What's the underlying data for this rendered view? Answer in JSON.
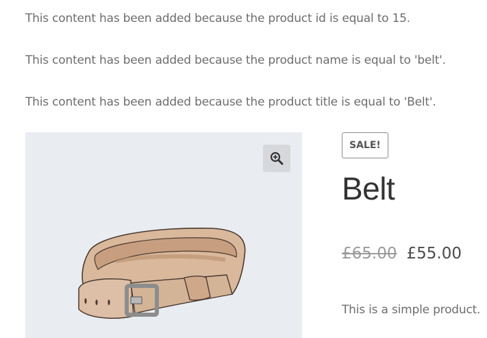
{
  "notices": [
    "This content has been added because the product id is equal to 15.",
    "This content has been added because the product name is equal to 'belt'.",
    "This content has been added because the product title is equal to 'Belt'."
  ],
  "gallery": {
    "zoom_icon": "magnifier-plus-icon",
    "image_alt": "belt-product-image"
  },
  "product": {
    "badge": "SALE!",
    "title": "Belt",
    "regular_price": "£65.00",
    "sale_price": "£55.00",
    "short_description": "This is a simple product."
  },
  "colors": {
    "gallery_bg": "#e9ecf0",
    "text": "#6d6d6d",
    "title": "#333333"
  }
}
